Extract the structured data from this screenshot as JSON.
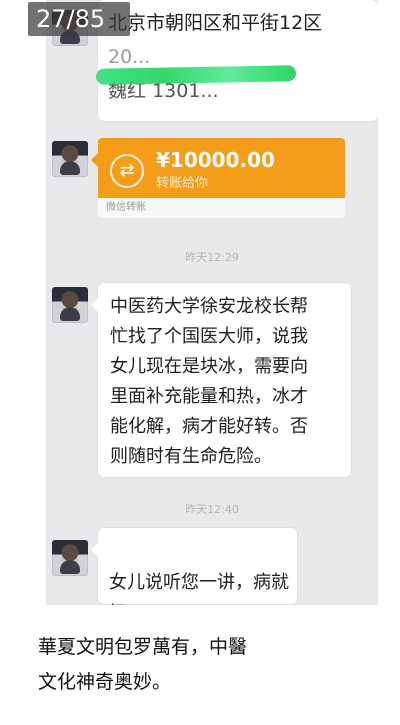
{
  "image_counter": "27/85",
  "chat": {
    "address_message": {
      "line1": "北京市朝阳区和平街12区",
      "line2": "20...",
      "line3_name": "魏红",
      "line3_phone": "1301..."
    },
    "transfer": {
      "icon": "swap-arrows-icon",
      "amount": "¥10000.00",
      "status": "转账给你",
      "footer": "微信转账"
    },
    "time1": "昨天12:29",
    "message": {
      "text": "中医药大学徐安龙校长帮\n忙找了个国医大师，说我\n女儿现在是块冰，需要向\n里面补充能量和热，冰才\n能化解，病才能好转。否\n则随时有生命危险。"
    },
    "time2": "昨天12:40",
    "reply": {
      "text": "女儿说听您一讲，病就好\n了",
      "emoji": "👍👍👍"
    }
  },
  "caption": "華夏文明包罗萬有，中醫\n文化神奇奥妙。",
  "colors": {
    "chat_background": "#e9e9eb",
    "transfer_orange": "#f49d18",
    "green_scribble": "#22d35e",
    "counter_overlay": "#3c3c3c"
  }
}
